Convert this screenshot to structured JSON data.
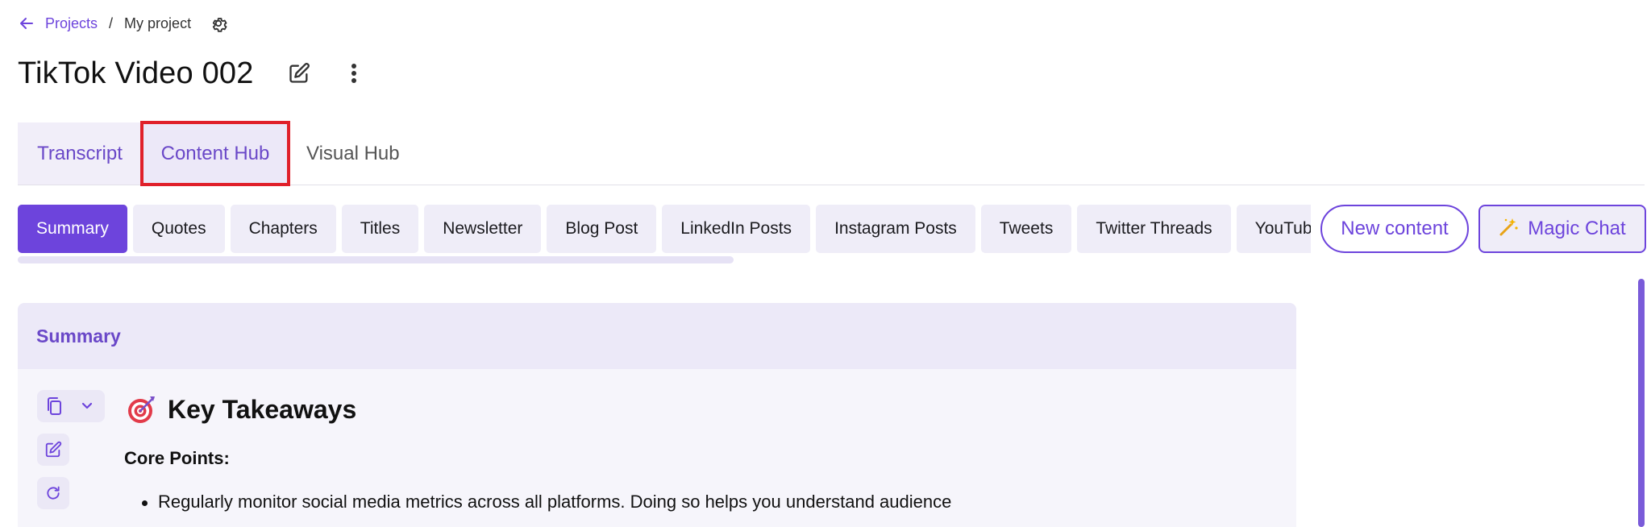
{
  "breadcrumb": {
    "back_icon": "arrow-left-icon",
    "projects_label": "Projects",
    "separator": "/",
    "current": "My project",
    "settings_icon": "gear-icon"
  },
  "header": {
    "title": "TikTok Video 002",
    "edit_icon": "edit-icon",
    "more_icon": "more-vertical-icon"
  },
  "main_tabs": [
    {
      "label": "Transcript"
    },
    {
      "label": "Content Hub",
      "highlighted": true
    },
    {
      "label": "Visual Hub"
    }
  ],
  "sub_tabs": [
    {
      "label": "Summary",
      "active": true
    },
    {
      "label": "Quotes"
    },
    {
      "label": "Chapters"
    },
    {
      "label": "Titles"
    },
    {
      "label": "Newsletter"
    },
    {
      "label": "Blog Post"
    },
    {
      "label": "LinkedIn Posts"
    },
    {
      "label": "Instagram Posts"
    },
    {
      "label": "Tweets"
    },
    {
      "label": "Twitter Threads"
    },
    {
      "label": "YouTube"
    }
  ],
  "actions": {
    "new_content": "New content",
    "magic_chat": "Magic Chat",
    "magic_chat_icon": "magic-wand-icon"
  },
  "card": {
    "header_title": "Summary",
    "tools": {
      "copy_icon": "copy-icon",
      "caret_icon": "chevron-down-icon",
      "edit_icon": "edit-icon",
      "refresh_icon": "refresh-icon"
    },
    "heading_emoji": "target-icon",
    "heading": "Key Takeaways",
    "subheading": "Core Points:",
    "bullets": [
      "Regularly monitor social media metrics across all platforms. Doing so helps you understand audience"
    ]
  },
  "colors": {
    "accent": "#6d44dc",
    "highlight_outline": "#e0202a",
    "tab_bg": "#efedf8"
  }
}
